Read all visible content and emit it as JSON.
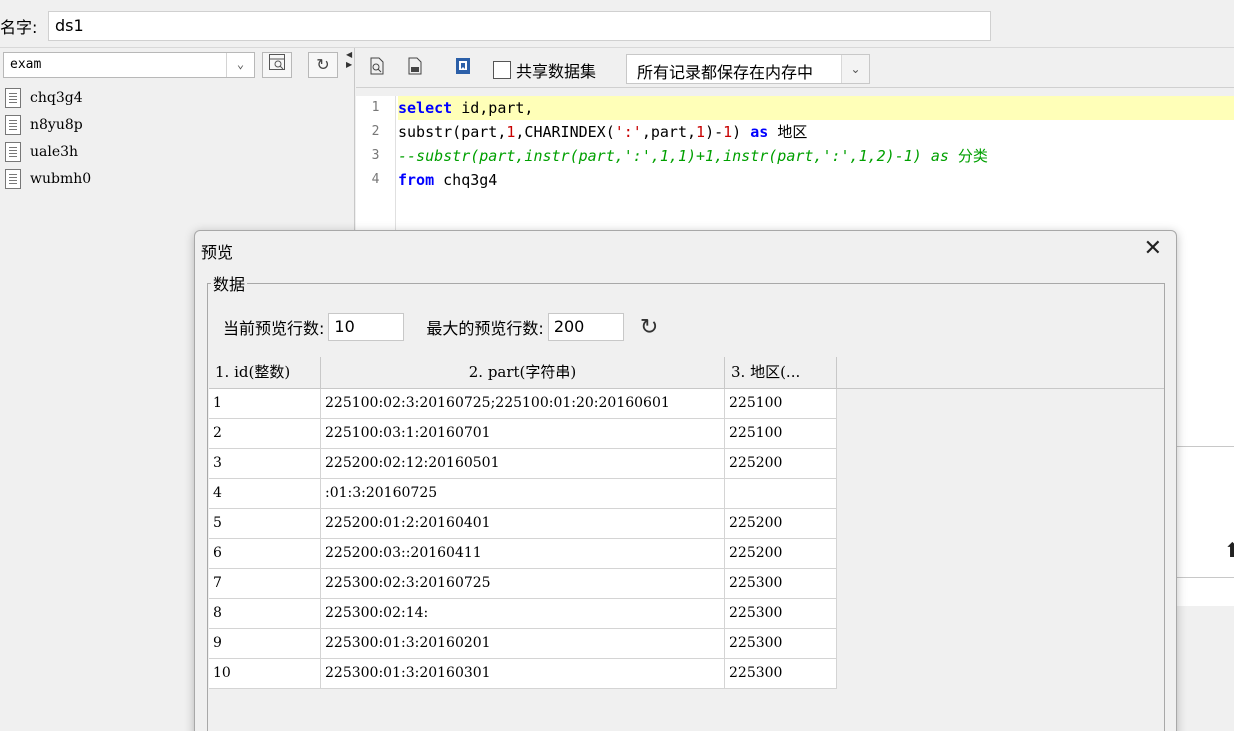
{
  "name_row": {
    "label": "名字:",
    "value": "ds1"
  },
  "left": {
    "db_selected": "exam",
    "tables": [
      "chq3g4",
      "n8yu8p",
      "uale3h",
      "wubmh0"
    ]
  },
  "toolbar": {
    "share_label": "共享数据集",
    "memory_option": "所有记录都保存在内存中"
  },
  "editor": {
    "line_numbers": [
      "1",
      "2",
      "3",
      "4"
    ]
  },
  "dialog": {
    "title": "预览",
    "group_label": "数据",
    "current_rows_label": "当前预览行数:",
    "current_rows_value": "10",
    "max_rows_label": "最大的预览行数:",
    "max_rows_value": "200",
    "columns": [
      "1. id(整数)",
      "2. part(字符串)",
      "3. 地区(..."
    ],
    "rows": [
      [
        "1",
        "225100:02:3:20160725;225100:01:20:20160601",
        "225100"
      ],
      [
        "2",
        "225100:03:1:20160701",
        "225100"
      ],
      [
        "3",
        "225200:02:12:20160501",
        "225200"
      ],
      [
        "4",
        ":01:3:20160725",
        ""
      ],
      [
        "5",
        "225200:01:2:20160401",
        "225200"
      ],
      [
        "6",
        "225200:03::20160411",
        "225200"
      ],
      [
        "7",
        "225300:02:3:20160725",
        "225300"
      ],
      [
        "8",
        "225300:02:14:",
        "225300"
      ],
      [
        "9",
        "225300:01:3:20160201",
        "225300"
      ],
      [
        "10",
        "225300:01:3:20160301",
        "225300"
      ]
    ]
  },
  "colors": {
    "active_line": "#ffffb8",
    "keyword": "#0000ff",
    "string": "#c80000",
    "comment": "#00a000"
  }
}
